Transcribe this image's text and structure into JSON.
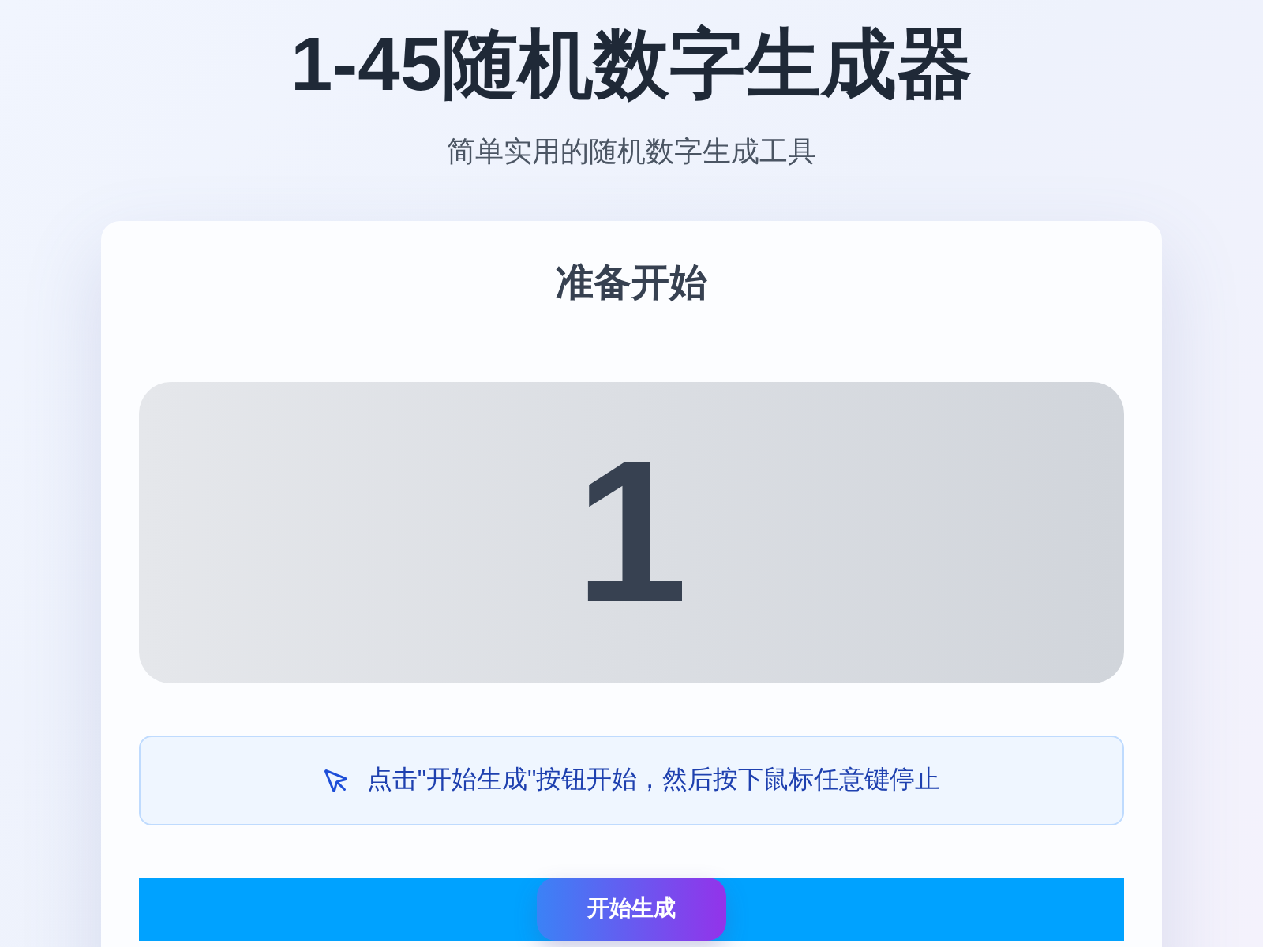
{
  "header": {
    "title": "1-45随机数字生成器",
    "subtitle": "简单实用的随机数字生成工具"
  },
  "card": {
    "status": "准备开始",
    "number": "1",
    "hint": "点击\"开始生成\"按钮开始，然后按下鼠标任意键停止",
    "button": "开始生成"
  }
}
